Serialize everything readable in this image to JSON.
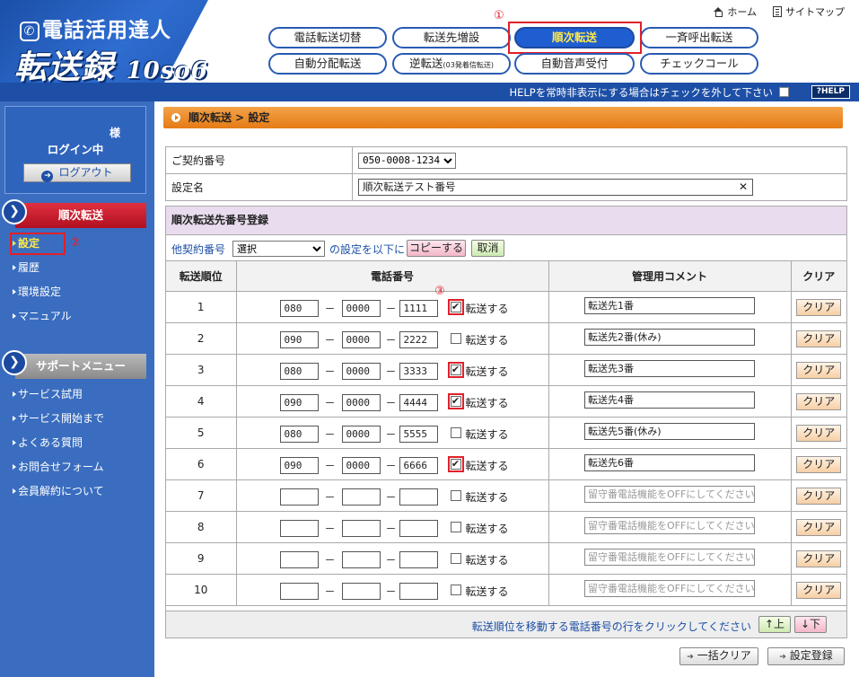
{
  "header": {
    "logo_title": "電話活用達人",
    "logo_product": "転送録",
    "logo_version": "10so6",
    "home_label": "ホーム",
    "sitemap_label": "サイトマップ",
    "help_text": "HELPを常時非表示にする場合はチェックを外して下さい",
    "help_button": "?HELP"
  },
  "nav": {
    "row1": [
      "電話転送切替",
      "転送先増設",
      "順次転送",
      "一斉呼出転送"
    ],
    "row2": [
      "自動分配転送",
      "逆転送",
      "自動音声受付",
      "チェックコール"
    ],
    "row2_small": "(03発着信転送)",
    "active": "順次転送"
  },
  "markers": {
    "m1": "①",
    "m2": "②",
    "m3": "③"
  },
  "sidebar": {
    "user_suffix": "様",
    "login_status": "ログイン中",
    "logout": "ログアウト",
    "section1": "順次転送",
    "section1_items": [
      "設定",
      "履歴",
      "環境設定",
      "マニュアル"
    ],
    "section2": "サポートメニュー",
    "section2_items": [
      "サービス試用",
      "サービス開始まで",
      "よくある質問",
      "お問合せフォーム",
      "会員解約について"
    ]
  },
  "breadcrumb": "順次転送 > 設定",
  "info": {
    "contract_label": "ご契約番号",
    "contract_value": "050-0008-1234",
    "name_label": "設定名",
    "name_value": "順次転送テスト番号"
  },
  "register": {
    "title": "順次転送先番号登録",
    "other_label": "他契約番号",
    "other_select": "選択",
    "copy_mid": "の設定を以下に",
    "copy_button": "コピーする",
    "cancel_button": "取消",
    "columns": [
      "転送順位",
      "電話番号",
      "管理用コメント",
      "クリア"
    ],
    "checkbox_label": "転送する",
    "clear_label": "クリア",
    "rows": [
      {
        "order": "1",
        "p1": "080",
        "p2": "0000",
        "p3": "1111",
        "checked": true,
        "comment": "転送先1番",
        "placeholder": false
      },
      {
        "order": "2",
        "p1": "090",
        "p2": "0000",
        "p3": "2222",
        "checked": false,
        "comment": "転送先2番(休み)",
        "placeholder": false
      },
      {
        "order": "3",
        "p1": "080",
        "p2": "0000",
        "p3": "3333",
        "checked": true,
        "comment": "転送先3番",
        "placeholder": false
      },
      {
        "order": "4",
        "p1": "090",
        "p2": "0000",
        "p3": "4444",
        "checked": true,
        "comment": "転送先4番",
        "placeholder": false
      },
      {
        "order": "5",
        "p1": "080",
        "p2": "0000",
        "p3": "5555",
        "checked": false,
        "comment": "転送先5番(休み)",
        "placeholder": false
      },
      {
        "order": "6",
        "p1": "090",
        "p2": "0000",
        "p3": "6666",
        "checked": true,
        "comment": "転送先6番",
        "placeholder": false
      },
      {
        "order": "7",
        "p1": "",
        "p2": "",
        "p3": "",
        "checked": false,
        "comment": "留守番電話機能をOFFにしてください",
        "placeholder": true
      },
      {
        "order": "8",
        "p1": "",
        "p2": "",
        "p3": "",
        "checked": false,
        "comment": "留守番電話機能をOFFにしてください",
        "placeholder": true
      },
      {
        "order": "9",
        "p1": "",
        "p2": "",
        "p3": "",
        "checked": false,
        "comment": "留守番電話機能をOFFにしてください",
        "placeholder": true
      },
      {
        "order": "10",
        "p1": "",
        "p2": "",
        "p3": "",
        "checked": false,
        "comment": "留守番電話機能をOFFにしてください",
        "placeholder": true
      }
    ],
    "move_text": "転送順位を移動する電話番号の行をクリックしてください",
    "up_button": "↑上",
    "down_button": "↓下"
  },
  "footer": {
    "bulk_clear": "一括クリア",
    "save": "設定登録"
  },
  "colors": {
    "accent": "#1d4fa6",
    "highlight_red": "#e0202a",
    "active_text": "#ffe84a"
  }
}
